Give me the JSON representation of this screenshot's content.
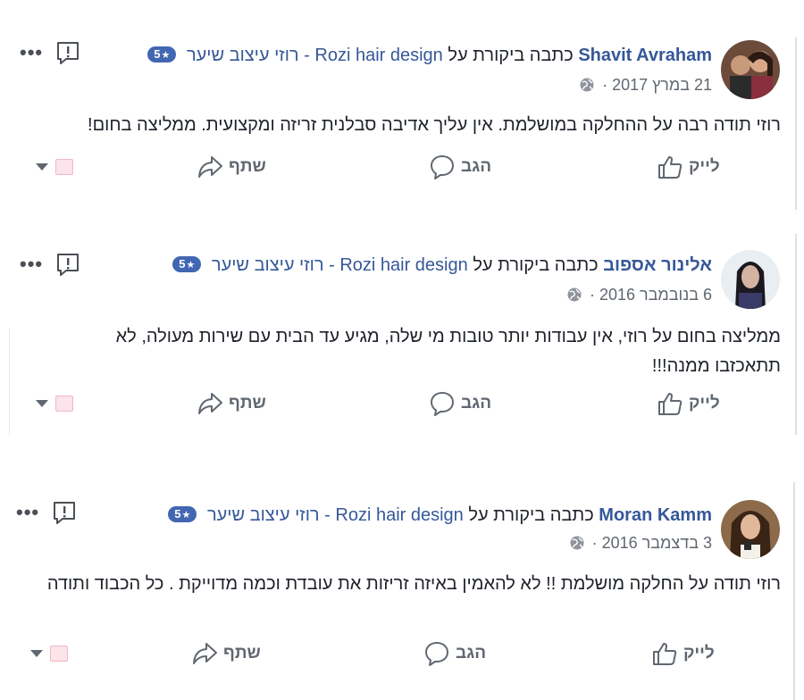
{
  "reviews": [
    {
      "author": "Shavit Avraham",
      "wrote": "כתבה ביקורת על",
      "page": "רוזי עיצוב שיער - Rozi hair design",
      "rating": "5",
      "date": "21 במרץ 2017",
      "sep": "·",
      "text": "רוזי תודה רבה על ההחלקה במושלמת. אין עליך אדיבה סבלנית זריזה ומקצועית. ממליצה בחום!",
      "like": "לייק",
      "comment": "הגב",
      "share": "שתף"
    },
    {
      "author": "אלינור אספוב",
      "wrote": "כתבה ביקורת על",
      "page": "רוזי עיצוב שיער - Rozi hair design",
      "rating": "5",
      "date": "6 בנובמבר 2016",
      "sep": "·",
      "text": "ממליצה בחום על רוזי, אין עבודות יותר טובות מי שלה, מגיע עד הבית עם שירות מעולה, לא תתאכזבו ממנה!!!",
      "like": "לייק",
      "comment": "הגב",
      "share": "שתף"
    },
    {
      "author": "Moran Kamm",
      "wrote": "כתבה ביקורת על",
      "page": "רוזי עיצוב שיער - Rozi hair design",
      "rating": "5",
      "date": "3 בדצמבר 2016",
      "sep": "·",
      "text": "רוזי תודה על החלקה מושלמת !! לא להאמין באיזה זריזות את עובדת וכמה מדוייקת . כל הכבוד ותודה",
      "like": "לייק",
      "comment": "הגב",
      "share": "שתף"
    }
  ],
  "icons": {
    "more": "more-options-icon",
    "report": "report-icon",
    "globe": "globe-icon",
    "like": "thumbs-up-icon",
    "comment": "comment-bubble-icon",
    "share": "share-arrow-icon"
  },
  "colors": {
    "link": "#365899",
    "badge": "#4267b2",
    "muted": "#606770"
  }
}
